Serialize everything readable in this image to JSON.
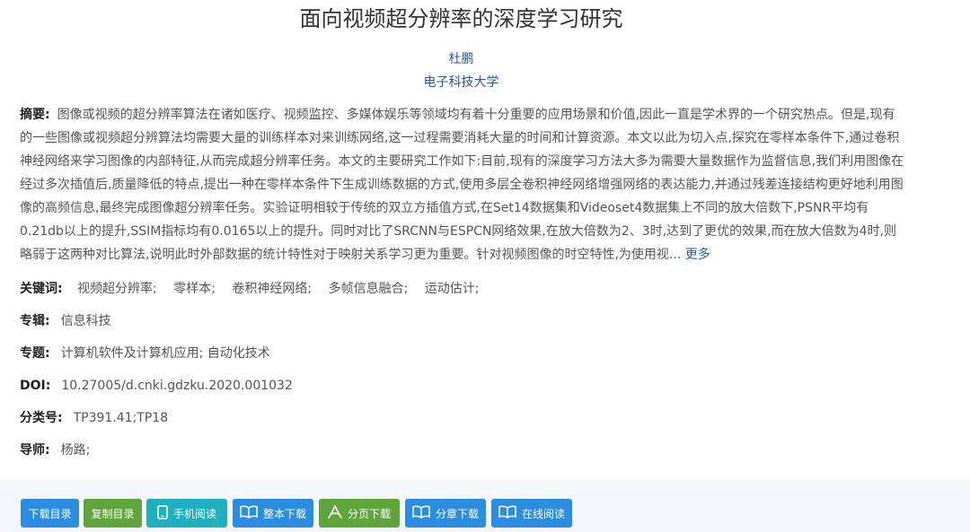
{
  "paper": {
    "title": "面向视频超分辨率的深度学习研究",
    "author": "杜鹏",
    "org": "电子科技大学"
  },
  "abstract": {
    "label": "摘要:",
    "text": "图像或视频的超分辨率算法在诸如医疗、视频监控、多媒体娱乐等领域均有着十分重要的应用场景和价值,因此一直是学术界的一个研究热点。但是,现有的一些图像或视频超分辨算法均需要大量的训练样本对来训练网络,这一过程需要消耗大量的时间和计算资源。本文以此为切入点,探究在零样本条件下,通过卷积神经网络来学习图像的内部特征,从而完成超分辨率任务。本文的主要研究工作如下:目前,现有的深度学习方法大多为需要大量数据作为监督信息,我们利用图像在经过多次插值后,质量降低的特点,提出一种在零样本条件下生成训练数据的方式,使用多层全卷积神经网络增强网络的表达能力,并通过残差连接结构更好地利用图像的高频信息,最终完成图像超分辨率任务。实验证明相较于传统的双立方插值方式,在Set14数据集和Videoset4数据集上不同的放大倍数下,PSNR平均有0.21db以上的提升,SSIM指标均有0.0165以上的提升。同时对比了SRCNN与ESPCN网络效果,在放大倍数为2、3时,达到了更优的效果,而在放大倍数为4时,则略弱于这两种对比算法,说明此时外部数据的统计特性对于映射关系学习更为重要。针对视频图像的时空特性,为使用视...",
    "more": "更多"
  },
  "meta": {
    "keywords_label": "关键词:",
    "keywords": [
      "视频超分辨率;",
      "零样本;",
      "卷积神经网络;",
      "多帧信息融合;",
      "运动估计;"
    ],
    "series_label": "专辑:",
    "series": "信息科技",
    "topic_label": "专题:",
    "topic": "计算机软件及计算机应用; 自动化技术",
    "doi_label": "DOI:",
    "doi": "10.27005/d.cnki.gdzku.2020.001032",
    "class_label": "分类号:",
    "class": "TP391.41;TP18",
    "advisor_label": "导师:",
    "advisor": "杨路;"
  },
  "toolbar": {
    "download_toc": "下载目录",
    "copy_toc": "复制目录",
    "mobile_read": "手机阅读",
    "full_download": "整本下载",
    "page_download": "分页下载",
    "chapter_download": "分章下载",
    "online_read": "在线阅读"
  },
  "colors": {
    "blue_button": "#2b8de0",
    "green_button": "#5fa53c",
    "teal_button": "#1fb0c0",
    "link": "#3355a0"
  }
}
